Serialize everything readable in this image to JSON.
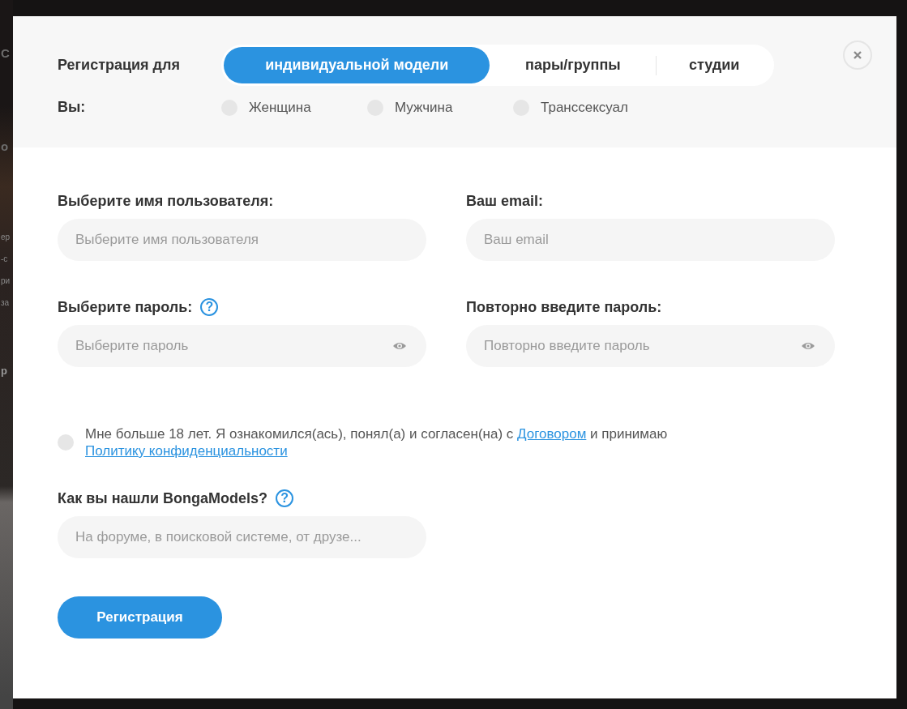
{
  "backdrop": {
    "fragments": [
      {
        "text": "С",
        "kind": "big"
      },
      {
        "text": "о",
        "kind": "big"
      },
      {
        "text": "ер",
        "kind": "small"
      },
      {
        "text": "-с",
        "kind": "small"
      },
      {
        "text": "ри",
        "kind": "small"
      },
      {
        "text": "за",
        "kind": "small"
      },
      {
        "text": "р",
        "kind": "bold"
      }
    ]
  },
  "modal": {
    "account_type": {
      "label": "Регистрация для",
      "options": [
        {
          "label": "индивидуальной модели",
          "selected": true
        },
        {
          "label": "пары/группы",
          "selected": false
        },
        {
          "label": "студии",
          "selected": false
        }
      ]
    },
    "gender": {
      "label": "Вы:",
      "options": [
        {
          "label": "Женщина",
          "selected": false
        },
        {
          "label": "Мужчина",
          "selected": false
        },
        {
          "label": "Транссексуал",
          "selected": false
        }
      ]
    },
    "fields": [
      {
        "label": "Выберите имя пользователя:",
        "placeholder": "Выберите имя пользователя",
        "password": false
      },
      {
        "label": "Ваш email:",
        "placeholder": "Ваш email",
        "password": false
      },
      {
        "label": "Выберите пароль:",
        "help": "?",
        "placeholder": "Выберите пароль",
        "password": true
      },
      {
        "label": "Повторно введите пароль:",
        "placeholder": "Повторно введите пароль",
        "password": true
      }
    ],
    "agreement": {
      "checked": false,
      "parts": [
        {
          "kind": "text",
          "text": "Мне больше 18 лет. Я ознакомился(ась), понял(а) и согласен(на) с "
        },
        {
          "kind": "link",
          "text": "Договором"
        },
        {
          "kind": "text",
          "text": " и принимаю "
        },
        {
          "kind": "link",
          "text": "Политику конфиденциальности"
        }
      ]
    },
    "source": {
      "label": "Как вы нашли BongaModels?",
      "help": "?",
      "placeholder": "На форуме, в поисковой системе, от друзе..."
    },
    "submit": "Регистрация"
  }
}
